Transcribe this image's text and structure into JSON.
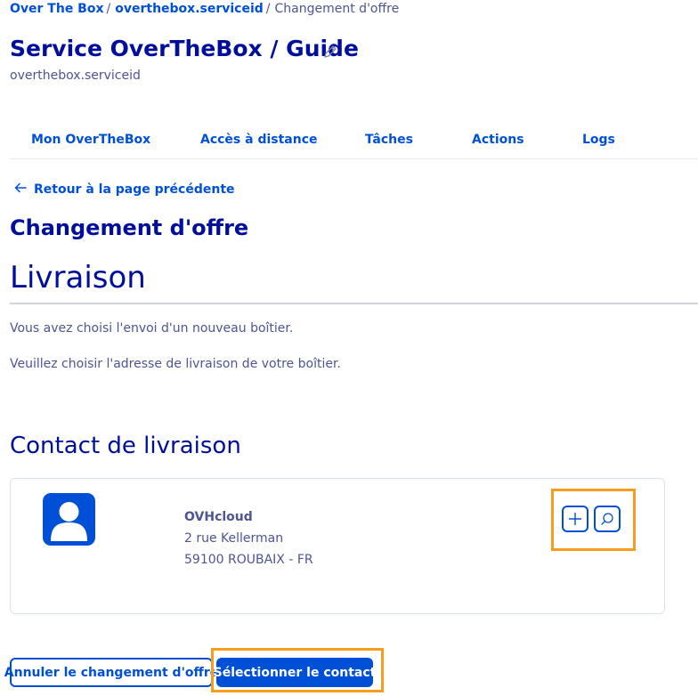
{
  "breadcrumb": {
    "items": [
      "Over The Box",
      "overthebox.serviceid"
    ],
    "separator": "/",
    "current": "Changement d'offre"
  },
  "header": {
    "title": "Service OverTheBox / Guide",
    "subtitle": "overthebox.serviceid"
  },
  "tabs": [
    {
      "label": "Mon OverTheBox"
    },
    {
      "label": "Accès à distance"
    },
    {
      "label": "Tâches"
    },
    {
      "label": "Actions"
    },
    {
      "label": "Logs"
    }
  ],
  "back_link": {
    "label": "Retour à la page précédente"
  },
  "section_title": "Changement d'offre",
  "delivery": {
    "title": "Livraison",
    "paragraph1": "Vous avez choisi l'envoi d'un nouveau boîtier.",
    "paragraph2": "Veuillez choisir l'adresse de livraison de votre boîtier."
  },
  "contact": {
    "title": "Contact de livraison",
    "name": "OVHcloud",
    "address_line1": "2 rue Kellerman",
    "address_line2": "59100 ROUBAIX - FR",
    "avatar_icon": "user-icon",
    "add_icon": "plus-icon",
    "search_icon": "search-icon"
  },
  "actions": {
    "cancel_label": "Annuler le changement d'offre",
    "select_label": "Sélectionner le contact"
  },
  "colors": {
    "primary": "#0050d7",
    "heading": "#000e9c",
    "text": "#4d5592",
    "highlight": "#f79d1e"
  }
}
